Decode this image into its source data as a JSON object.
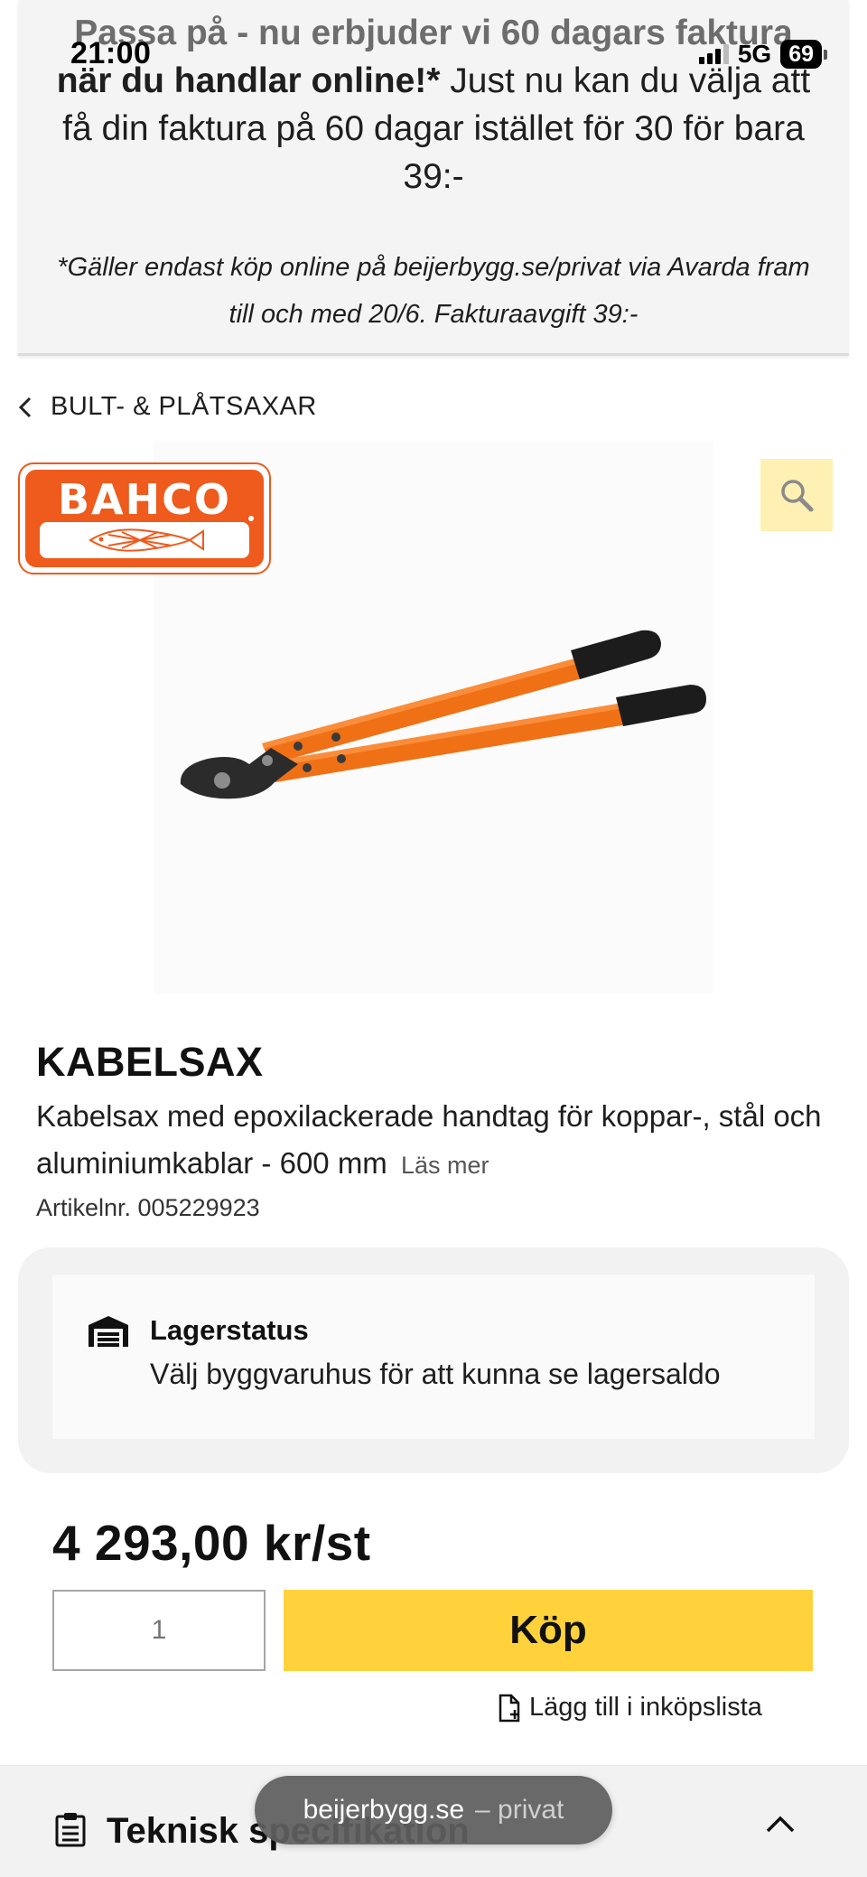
{
  "status_bar": {
    "time": "21:00",
    "network": "5G",
    "battery": "69"
  },
  "promo": {
    "line_faded": "Passa på - nu erbjuder vi 60 dagars faktura",
    "line_bold": "när du handlar online!*",
    "line_rest": " Just nu kan du välja att få din faktura på 60 dagar istället för 30 för bara 39:-",
    "note": "*Gäller endast köp online på beijerbygg.se/privat via Avarda fram till och med 20/6. Fakturaavgift 39:-"
  },
  "breadcrumb": {
    "label": "BULT- & PLÅTSAXAR",
    "icon": "chevron-left-icon"
  },
  "brand": {
    "name": "BAHCO",
    "color": "#ee5b1d"
  },
  "product": {
    "title": "KABELSAX",
    "description": "Kabelsax med epoxilackerade handtag för koppar-, stål och aluminiumkablar - 600 mm",
    "read_more": "Läs mer",
    "article_number": "Artikelnr. 005229923"
  },
  "stock": {
    "title": "Lagerstatus",
    "text": "Välj byggvaruhus för att kunna se lagersaldo",
    "icon": "warehouse-icon"
  },
  "purchase": {
    "price": "4 293,00 kr/st",
    "quantity_placeholder": "1",
    "buy_label": "Köp",
    "shopping_list_label": "Lägg till i inköpslista",
    "accent_color": "#ffd23c"
  },
  "tech_spec": {
    "title": "Teknisk specifikation",
    "icon": "clipboard-icon"
  },
  "browser": {
    "domain": "beijerbygg.se",
    "suffix": "– privat"
  }
}
